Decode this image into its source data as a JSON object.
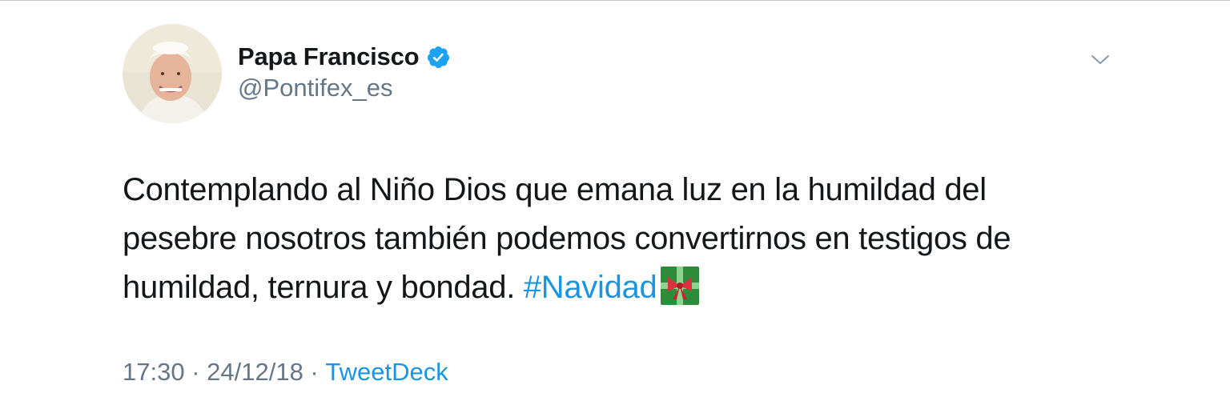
{
  "author": {
    "display_name": "Papa Francisco",
    "handle": "@Pontifex_es",
    "verified": true,
    "avatar_icon": "avatar-photo"
  },
  "tweet": {
    "text_before_hashtag": "Contemplando al Niño Dios que emana luz en la humildad del pesebre nosotros también podemos convertirnos en testigos de humildad, ternura y bondad. ",
    "hashtag": "#Navidad",
    "emoji": "wrapped-gift-emoji"
  },
  "meta": {
    "time": "17:30",
    "separator1": " · ",
    "date": "24/12/18",
    "separator2": " · ",
    "source": "TweetDeck"
  },
  "colors": {
    "link": "#1b95e0",
    "text": "#14171a",
    "secondary": "#657786",
    "verified": "#1da1f2"
  },
  "icons": {
    "verified": "verified-badge-icon",
    "menu": "chevron-down-icon"
  }
}
